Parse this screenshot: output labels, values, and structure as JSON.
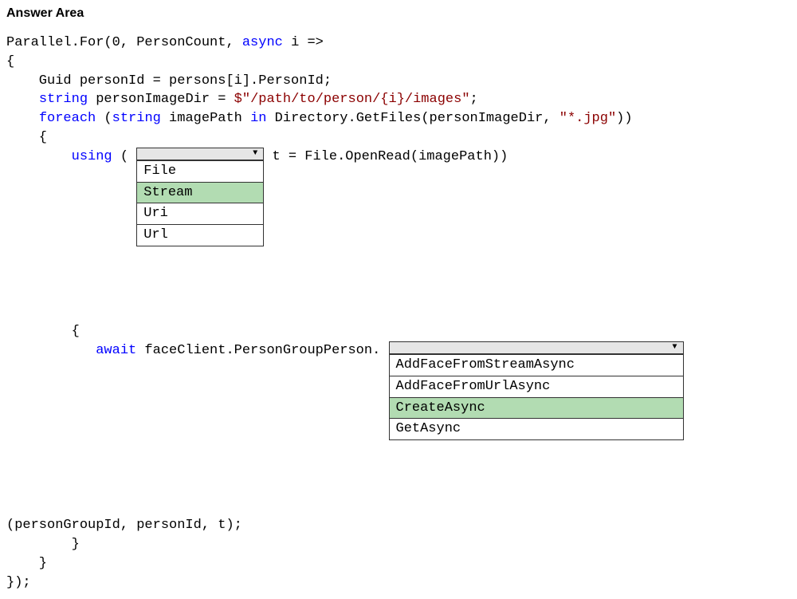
{
  "header": {
    "title": "Answer Area"
  },
  "code": {
    "line1_a": "Parallel.For(0, PersonCount, ",
    "line1_kw": "async",
    "line1_b": " i =>",
    "line2": "{",
    "line3": "    Guid personId = persons[i].PersonId;",
    "line4_a": "    ",
    "line4_kw": "string",
    "line4_b": " personImageDir = ",
    "line4_str": "$\"/path/to/person/{i}/images\"",
    "line4_c": ";",
    "line5_a": "    ",
    "line5_kw1": "foreach",
    "line5_b": " (",
    "line5_kw2": "string",
    "line5_c": " imagePath ",
    "line5_kw3": "in",
    "line5_d": " Directory.GetFiles(personImageDir, ",
    "line5_str": "\"*.jpg\"",
    "line5_e": "))",
    "line6": "    {",
    "line7_a": "        ",
    "line7_kw": "using",
    "line7_b": " ( ",
    "line7_c": " t = File.OpenRead(imagePath))",
    "line10": "        {",
    "line11_a": "           ",
    "line11_kw": "await",
    "line11_b": " faceClient.PersonGroupPerson. ",
    "line13": "(personGroupId, personId, t);",
    "line14": "        }",
    "line15": "    }",
    "line16": "});"
  },
  "dropdown1": {
    "selected": "",
    "options": [
      "File",
      "Stream",
      "Uri",
      "Url"
    ],
    "highlighted": "Stream"
  },
  "dropdown2": {
    "selected": "",
    "options": [
      "AddFaceFromStreamAsync",
      "AddFaceFromUrlAsync",
      "CreateAsync",
      "GetAsync"
    ],
    "highlighted": "CreateAsync"
  }
}
